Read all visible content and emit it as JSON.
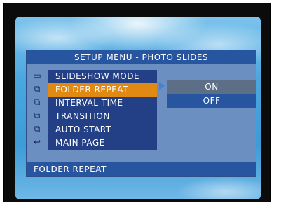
{
  "menu": {
    "title": "SETUP MENU - PHOTO SLIDES",
    "items": [
      {
        "label": "SLIDESHOW MODE",
        "icon": "slideshow-icon"
      },
      {
        "label": "FOLDER REPEAT",
        "icon": "folder-repeat-icon"
      },
      {
        "label": "INTERVAL TIME",
        "icon": "interval-time-icon"
      },
      {
        "label": "TRANSITION",
        "icon": "transition-icon"
      },
      {
        "label": "AUTO START",
        "icon": "auto-start-icon"
      },
      {
        "label": "MAIN PAGE",
        "icon": "return-icon"
      }
    ],
    "selected_index": 1
  },
  "submenu": {
    "options": [
      "ON",
      "OFF"
    ],
    "highlighted": "ON"
  },
  "status_bar": "FOLDER REPEAT",
  "colors": {
    "panel_bg": "#6a8fc0",
    "title_bar": "#2855a0",
    "menu_bg": "#233f86",
    "selected": "#e08a14",
    "submenu_on": "#5c6f87"
  }
}
